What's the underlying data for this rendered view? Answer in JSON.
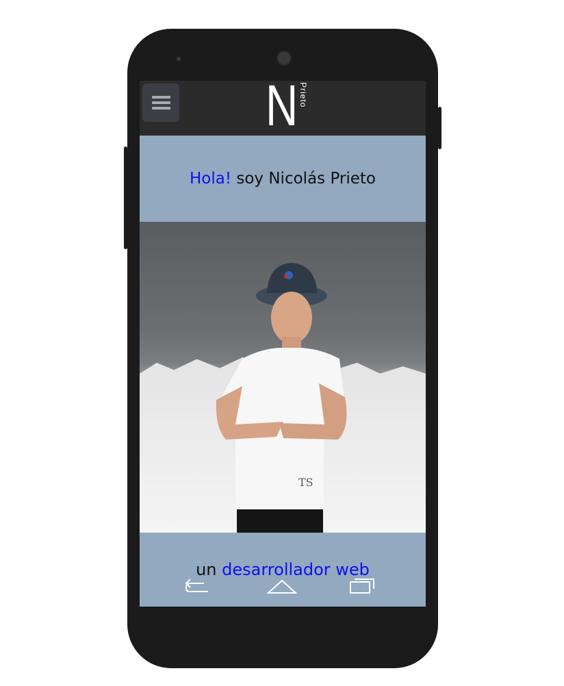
{
  "header": {
    "logo_letter": "N",
    "logo_subtext": "Prieto",
    "menu_icon": "hamburger-menu-icon"
  },
  "greeting": {
    "hello": "Hola!",
    "rest": " soy Nicolás Prieto"
  },
  "photo": {
    "icon": "portrait-photo"
  },
  "tagline": {
    "prefix": "un ",
    "highlight": "desarrollador web"
  },
  "navigation": {
    "back_icon": "back-icon",
    "home_icon": "home-icon",
    "recents_icon": "recents-icon"
  },
  "colors": {
    "accent_blue": "#1010ee",
    "header_bg": "#2b2b2b",
    "section_bg": "#92a9c0"
  }
}
